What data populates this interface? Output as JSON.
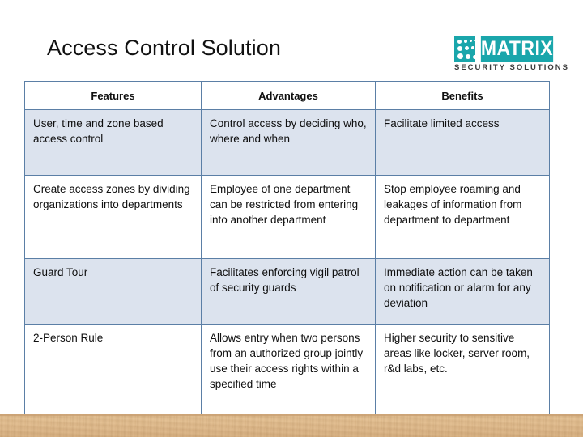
{
  "slide": {
    "title": "Access Control Solution",
    "background_color": "#ffffff",
    "bottom_band_color": "#ddb687"
  },
  "logo": {
    "name": "matrix-logo",
    "wordmark": "MATRIX",
    "tagline": "SECURITY SOLUTIONS",
    "accent_color": "#1aa6ab",
    "tagline_color": "#3b3b3b"
  },
  "table": {
    "border_color": "#5b7fa6",
    "shade_color": "#dce3ee",
    "headers": [
      "Features",
      "Advantages",
      "Benefits"
    ],
    "rows": [
      {
        "shaded": true,
        "features": "User, time and zone based access control",
        "advantages": "Control access by deciding who, where and when",
        "benefits": "Facilitate limited access"
      },
      {
        "shaded": false,
        "features": "Create access zones by dividing organizations into departments",
        "advantages": "Employee of one department can be restricted from entering into another department",
        "benefits": "Stop employee roaming and leakages of information from department to department"
      },
      {
        "shaded": true,
        "features": "Guard Tour",
        "advantages": "Facilitates enforcing vigil patrol of security guards",
        "benefits": "Immediate action can be taken on notification or alarm for any deviation"
      },
      {
        "shaded": false,
        "features": "2-Person Rule",
        "advantages": "Allows entry when two persons from an authorized group jointly use their access rights within a specified time",
        "benefits": "Higher security to sensitive areas like locker, server room, r&d labs, etc."
      }
    ]
  }
}
